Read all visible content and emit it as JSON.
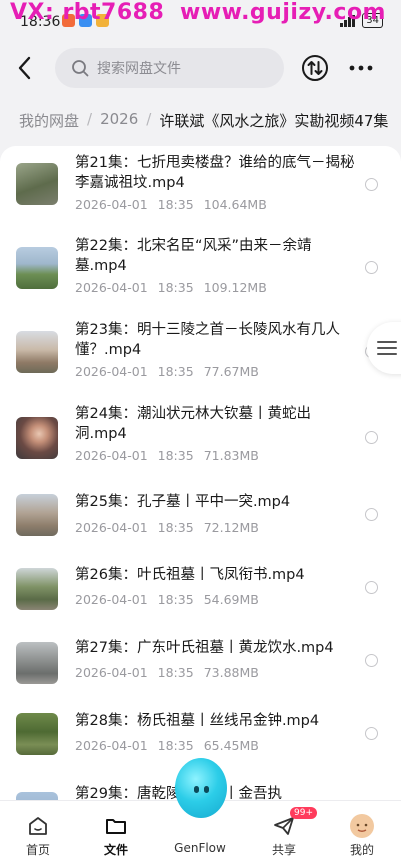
{
  "watermark": {
    "left": "VX: rbt7688",
    "right": "www.gujizy.com"
  },
  "status": {
    "time": "18:36",
    "battery": "34"
  },
  "search": {
    "placeholder": "搜索网盘文件"
  },
  "breadcrumb": [
    "我的网盘",
    "2026",
    "许联斌《风水之旅》实勘视频47集"
  ],
  "files": [
    {
      "name": "第21集：七折甩卖楼盘？谁给的底气－揭秘李嘉诚祖坟.mp4",
      "date": "2026-04-01",
      "time": "18:35",
      "size": "104.64MB"
    },
    {
      "name": "第22集：北宋名臣“风采”由来－余靖墓.mp4",
      "date": "2026-04-01",
      "time": "18:35",
      "size": "109.12MB"
    },
    {
      "name": "第23集：明十三陵之首－长陵风水有几人懂？.mp4",
      "date": "2026-04-01",
      "time": "18:35",
      "size": "77.67MB"
    },
    {
      "name": "第24集：潮汕状元林大钦墓丨黄蛇出洞.mp4",
      "date": "2026-04-01",
      "time": "18:35",
      "size": "71.83MB"
    },
    {
      "name": "第25集：孔子墓丨平中一突.mp4",
      "date": "2026-04-01",
      "time": "18:35",
      "size": "72.12MB"
    },
    {
      "name": "第26集：叶氏祖墓丨飞凤衔书.mp4",
      "date": "2026-04-01",
      "time": "18:35",
      "size": "54.69MB"
    },
    {
      "name": "第27集：广东叶氏祖墓丨黄龙饮水.mp4",
      "date": "2026-04-01",
      "time": "18:35",
      "size": "73.88MB"
    },
    {
      "name": "第28集：杨氏祖墓丨丝线吊金钟.mp4",
      "date": "2026-04-01",
      "time": "18:35",
      "size": "65.45MB"
    },
    {
      "name": "第29集：唐乾陵丨玉墓丨金吾执",
      "date": "",
      "time": "",
      "size": ""
    }
  ],
  "nav": {
    "home": "首页",
    "files": "文件",
    "genflow": "GenFlow",
    "share": "共享",
    "mine": "我的",
    "share_badge": "99+"
  },
  "colors": {
    "watermark": "#e61eb5",
    "accent": "#1a1a1a",
    "badge": "#ff3b5c",
    "orb": "#2ccde8"
  }
}
